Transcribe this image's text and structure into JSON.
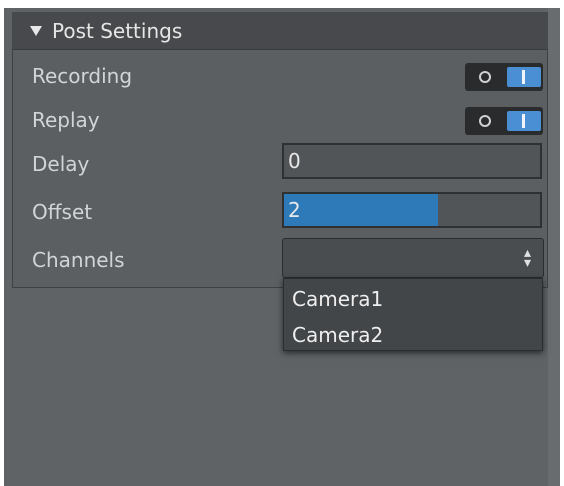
{
  "panel": {
    "title": "Post Settings"
  },
  "rows": {
    "recording": {
      "label": "Recording",
      "enabled": true
    },
    "replay": {
      "label": "Replay",
      "enabled": true
    },
    "delay": {
      "label": "Delay",
      "value": "0"
    },
    "offset": {
      "label": "Offset",
      "value": "2",
      "fill_fraction": 0.6
    },
    "channels": {
      "label": "Channels",
      "selected": "",
      "options": [
        "Camera1",
        "Camera2"
      ]
    }
  },
  "colors": {
    "accent": "#4a8fd4",
    "offset_fill": "#2e7ab8",
    "panel_bg": "#5b5f62",
    "header_bg": "#47494c"
  },
  "icons": {
    "collapse": "triangle-down-icon",
    "select_arrows": "up-down-arrows-icon"
  }
}
